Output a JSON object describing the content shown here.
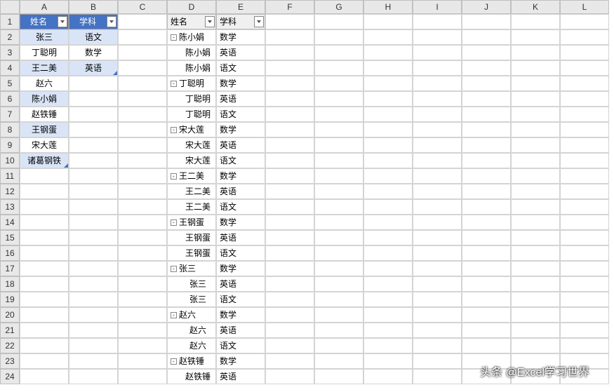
{
  "columns": [
    "A",
    "B",
    "C",
    "D",
    "E",
    "F",
    "G",
    "H",
    "I",
    "J",
    "K",
    "L"
  ],
  "rowCount": 24,
  "table1": {
    "headers": [
      "姓名",
      "学科"
    ],
    "rows": [
      {
        "name": "张三",
        "subj": "语文",
        "sel": true
      },
      {
        "name": "丁聪明",
        "subj": "数学",
        "sel": false
      },
      {
        "name": "王二美",
        "subj": "英语",
        "sel": true,
        "mark": true
      },
      {
        "name": "赵六",
        "subj": "",
        "sel": false
      },
      {
        "name": "陈小娟",
        "subj": "",
        "sel": true
      },
      {
        "name": "赵铁锤",
        "subj": "",
        "sel": false
      },
      {
        "name": "王钢蛋",
        "subj": "",
        "sel": true
      },
      {
        "name": "宋大莲",
        "subj": "",
        "sel": false
      },
      {
        "name": "诸葛钢铁",
        "subj": "",
        "sel": true,
        "markA": true
      }
    ]
  },
  "pivot": {
    "headers": [
      "姓名",
      "学科"
    ],
    "rows": [
      {
        "d": "陈小娟",
        "e": "数学",
        "g": true
      },
      {
        "d": "陈小娟",
        "e": "英语",
        "g": false
      },
      {
        "d": "陈小娟",
        "e": "语文",
        "g": false
      },
      {
        "d": "丁聪明",
        "e": "数学",
        "g": true
      },
      {
        "d": "丁聪明",
        "e": "英语",
        "g": false
      },
      {
        "d": "丁聪明",
        "e": "语文",
        "g": false
      },
      {
        "d": "宋大莲",
        "e": "数学",
        "g": true
      },
      {
        "d": "宋大莲",
        "e": "英语",
        "g": false
      },
      {
        "d": "宋大莲",
        "e": "语文",
        "g": false
      },
      {
        "d": "王二美",
        "e": "数学",
        "g": true
      },
      {
        "d": "王二美",
        "e": "英语",
        "g": false
      },
      {
        "d": "王二美",
        "e": "语文",
        "g": false
      },
      {
        "d": "王钢蛋",
        "e": "数学",
        "g": true
      },
      {
        "d": "王钢蛋",
        "e": "英语",
        "g": false
      },
      {
        "d": "王钢蛋",
        "e": "语文",
        "g": false
      },
      {
        "d": "张三",
        "e": "数学",
        "g": true
      },
      {
        "d": "张三",
        "e": "英语",
        "g": false
      },
      {
        "d": "张三",
        "e": "语文",
        "g": false
      },
      {
        "d": "赵六",
        "e": "数学",
        "g": true
      },
      {
        "d": "赵六",
        "e": "英语",
        "g": false
      },
      {
        "d": "赵六",
        "e": "语文",
        "g": false
      },
      {
        "d": "赵铁锤",
        "e": "数学",
        "g": true
      },
      {
        "d": "赵铁锤",
        "e": "英语",
        "g": false
      }
    ]
  },
  "watermark": "头条 @Excel学习世界"
}
